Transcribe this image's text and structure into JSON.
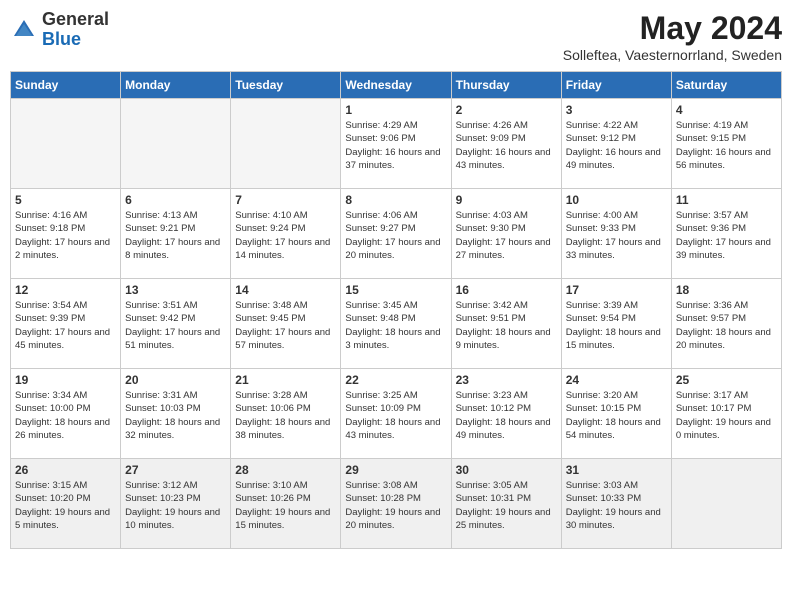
{
  "logo": {
    "general": "General",
    "blue": "Blue"
  },
  "title": "May 2024",
  "location": "Solleftea, Vaesternorrland, Sweden",
  "days_of_week": [
    "Sunday",
    "Monday",
    "Tuesday",
    "Wednesday",
    "Thursday",
    "Friday",
    "Saturday"
  ],
  "weeks": [
    [
      {
        "day": "",
        "info": "",
        "empty": true
      },
      {
        "day": "",
        "info": "",
        "empty": true
      },
      {
        "day": "",
        "info": "",
        "empty": true
      },
      {
        "day": "1",
        "info": "Sunrise: 4:29 AM\nSunset: 9:06 PM\nDaylight: 16 hours and 37 minutes."
      },
      {
        "day": "2",
        "info": "Sunrise: 4:26 AM\nSunset: 9:09 PM\nDaylight: 16 hours and 43 minutes."
      },
      {
        "day": "3",
        "info": "Sunrise: 4:22 AM\nSunset: 9:12 PM\nDaylight: 16 hours and 49 minutes."
      },
      {
        "day": "4",
        "info": "Sunrise: 4:19 AM\nSunset: 9:15 PM\nDaylight: 16 hours and 56 minutes."
      }
    ],
    [
      {
        "day": "5",
        "info": "Sunrise: 4:16 AM\nSunset: 9:18 PM\nDaylight: 17 hours and 2 minutes."
      },
      {
        "day": "6",
        "info": "Sunrise: 4:13 AM\nSunset: 9:21 PM\nDaylight: 17 hours and 8 minutes."
      },
      {
        "day": "7",
        "info": "Sunrise: 4:10 AM\nSunset: 9:24 PM\nDaylight: 17 hours and 14 minutes."
      },
      {
        "day": "8",
        "info": "Sunrise: 4:06 AM\nSunset: 9:27 PM\nDaylight: 17 hours and 20 minutes."
      },
      {
        "day": "9",
        "info": "Sunrise: 4:03 AM\nSunset: 9:30 PM\nDaylight: 17 hours and 27 minutes."
      },
      {
        "day": "10",
        "info": "Sunrise: 4:00 AM\nSunset: 9:33 PM\nDaylight: 17 hours and 33 minutes."
      },
      {
        "day": "11",
        "info": "Sunrise: 3:57 AM\nSunset: 9:36 PM\nDaylight: 17 hours and 39 minutes."
      }
    ],
    [
      {
        "day": "12",
        "info": "Sunrise: 3:54 AM\nSunset: 9:39 PM\nDaylight: 17 hours and 45 minutes."
      },
      {
        "day": "13",
        "info": "Sunrise: 3:51 AM\nSunset: 9:42 PM\nDaylight: 17 hours and 51 minutes."
      },
      {
        "day": "14",
        "info": "Sunrise: 3:48 AM\nSunset: 9:45 PM\nDaylight: 17 hours and 57 minutes."
      },
      {
        "day": "15",
        "info": "Sunrise: 3:45 AM\nSunset: 9:48 PM\nDaylight: 18 hours and 3 minutes."
      },
      {
        "day": "16",
        "info": "Sunrise: 3:42 AM\nSunset: 9:51 PM\nDaylight: 18 hours and 9 minutes."
      },
      {
        "day": "17",
        "info": "Sunrise: 3:39 AM\nSunset: 9:54 PM\nDaylight: 18 hours and 15 minutes."
      },
      {
        "day": "18",
        "info": "Sunrise: 3:36 AM\nSunset: 9:57 PM\nDaylight: 18 hours and 20 minutes."
      }
    ],
    [
      {
        "day": "19",
        "info": "Sunrise: 3:34 AM\nSunset: 10:00 PM\nDaylight: 18 hours and 26 minutes."
      },
      {
        "day": "20",
        "info": "Sunrise: 3:31 AM\nSunset: 10:03 PM\nDaylight: 18 hours and 32 minutes."
      },
      {
        "day": "21",
        "info": "Sunrise: 3:28 AM\nSunset: 10:06 PM\nDaylight: 18 hours and 38 minutes."
      },
      {
        "day": "22",
        "info": "Sunrise: 3:25 AM\nSunset: 10:09 PM\nDaylight: 18 hours and 43 minutes."
      },
      {
        "day": "23",
        "info": "Sunrise: 3:23 AM\nSunset: 10:12 PM\nDaylight: 18 hours and 49 minutes."
      },
      {
        "day": "24",
        "info": "Sunrise: 3:20 AM\nSunset: 10:15 PM\nDaylight: 18 hours and 54 minutes."
      },
      {
        "day": "25",
        "info": "Sunrise: 3:17 AM\nSunset: 10:17 PM\nDaylight: 19 hours and 0 minutes."
      }
    ],
    [
      {
        "day": "26",
        "info": "Sunrise: 3:15 AM\nSunset: 10:20 PM\nDaylight: 19 hours and 5 minutes.",
        "last": true
      },
      {
        "day": "27",
        "info": "Sunrise: 3:12 AM\nSunset: 10:23 PM\nDaylight: 19 hours and 10 minutes.",
        "last": true
      },
      {
        "day": "28",
        "info": "Sunrise: 3:10 AM\nSunset: 10:26 PM\nDaylight: 19 hours and 15 minutes.",
        "last": true
      },
      {
        "day": "29",
        "info": "Sunrise: 3:08 AM\nSunset: 10:28 PM\nDaylight: 19 hours and 20 minutes.",
        "last": true
      },
      {
        "day": "30",
        "info": "Sunrise: 3:05 AM\nSunset: 10:31 PM\nDaylight: 19 hours and 25 minutes.",
        "last": true
      },
      {
        "day": "31",
        "info": "Sunrise: 3:03 AM\nSunset: 10:33 PM\nDaylight: 19 hours and 30 minutes.",
        "last": true
      },
      {
        "day": "",
        "info": "",
        "empty": true,
        "last": true
      }
    ]
  ]
}
